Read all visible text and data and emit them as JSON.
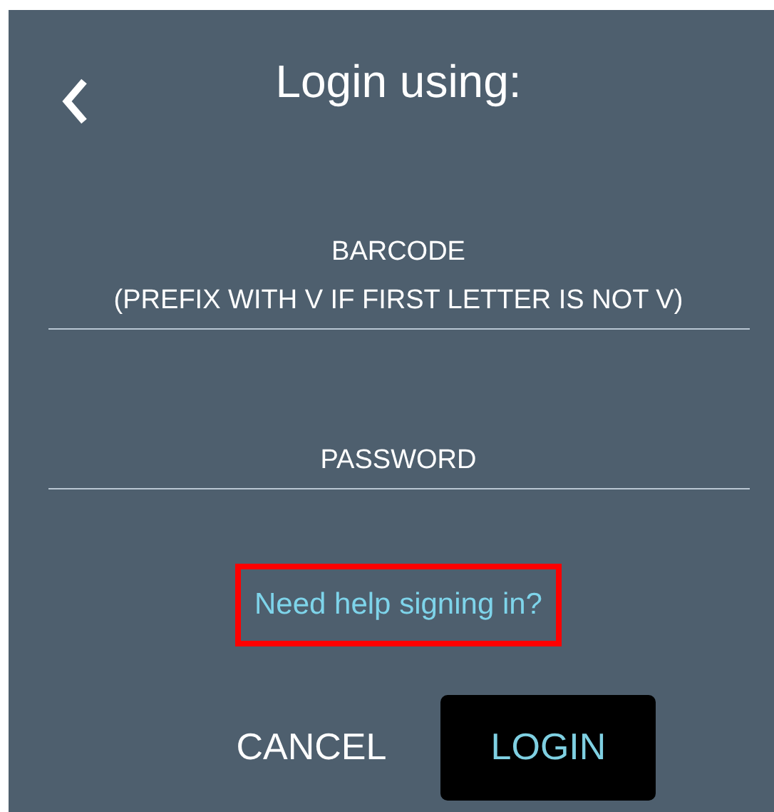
{
  "dialog": {
    "title": "Login using:",
    "fields": [
      {
        "label": "BARCODE",
        "hint": "(PREFIX WITH V IF FIRST LETTER IS NOT V)"
      },
      {
        "label": "PASSWORD"
      }
    ],
    "help_link": {
      "text": "Need help signing in?",
      "highlighted": true
    },
    "buttons": [
      {
        "label": "CANCEL",
        "kind": "text"
      },
      {
        "label": "LOGIN",
        "kind": "primary"
      }
    ]
  }
}
